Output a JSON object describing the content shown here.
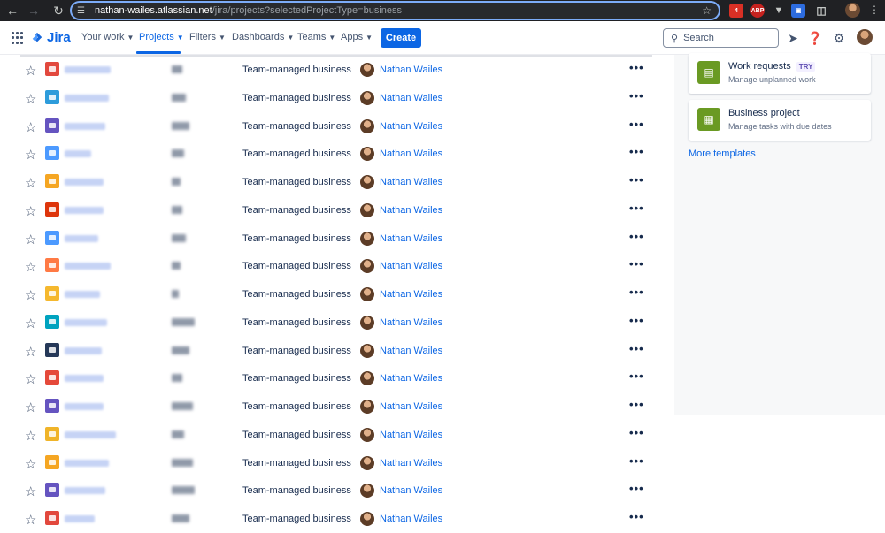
{
  "browser": {
    "url_host": "nathan-wailes.atlassian.net",
    "url_path": "/jira/projects?selectedProjectType=business",
    "extensions": {
      "pdf_badge": "4",
      "abp": "ABP"
    }
  },
  "header": {
    "logo_text": "Jira",
    "nav": [
      {
        "label": "Your work"
      },
      {
        "label": "Projects"
      },
      {
        "label": "Filters"
      },
      {
        "label": "Dashboards"
      },
      {
        "label": "Teams"
      },
      {
        "label": "Apps"
      }
    ],
    "create_label": "Create",
    "search_placeholder": "Search"
  },
  "projects": [
    {
      "icon_color": "#e2483d",
      "type": "Team-managed business",
      "lead": "Nathan Wailes"
    },
    {
      "icon_color": "#2d9cdb",
      "type": "Team-managed business",
      "lead": "Nathan Wailes"
    },
    {
      "icon_color": "#6554c0",
      "type": "Team-managed business",
      "lead": "Nathan Wailes"
    },
    {
      "icon_color": "#4c9aff",
      "type": "Team-managed business",
      "lead": "Nathan Wailes"
    },
    {
      "icon_color": "#f5a623",
      "type": "Team-managed business",
      "lead": "Nathan Wailes"
    },
    {
      "icon_color": "#de350b",
      "type": "Team-managed business",
      "lead": "Nathan Wailes"
    },
    {
      "icon_color": "#4c9aff",
      "type": "Team-managed business",
      "lead": "Nathan Wailes"
    },
    {
      "icon_color": "#ff7a45",
      "type": "Team-managed business",
      "lead": "Nathan Wailes"
    },
    {
      "icon_color": "#f5b82e",
      "type": "Team-managed business",
      "lead": "Nathan Wailes"
    },
    {
      "icon_color": "#00a3bf",
      "type": "Team-managed business",
      "lead": "Nathan Wailes"
    },
    {
      "icon_color": "#253858",
      "type": "Team-managed business",
      "lead": "Nathan Wailes"
    },
    {
      "icon_color": "#e5493a",
      "type": "Team-managed business",
      "lead": "Nathan Wailes"
    },
    {
      "icon_color": "#6554c0",
      "type": "Team-managed business",
      "lead": "Nathan Wailes"
    },
    {
      "icon_color": "#f0b429",
      "type": "Team-managed business",
      "lead": "Nathan Wailes"
    },
    {
      "icon_color": "#f5a623",
      "type": "Team-managed business",
      "lead": "Nathan Wailes"
    },
    {
      "icon_color": "#6554c0",
      "type": "Team-managed business",
      "lead": "Nathan Wailes"
    },
    {
      "icon_color": "#e2483d",
      "type": "Team-managed business",
      "lead": "Nathan Wailes"
    }
  ],
  "templates": {
    "cards": [
      {
        "title": "Work requests",
        "badge": "TRY",
        "desc": "Manage unplanned work",
        "icon": "form-icon"
      },
      {
        "title": "Business project",
        "badge": "",
        "desc": "Manage tasks with due dates",
        "icon": "calendar-icon"
      }
    ],
    "more_label": "More templates"
  }
}
